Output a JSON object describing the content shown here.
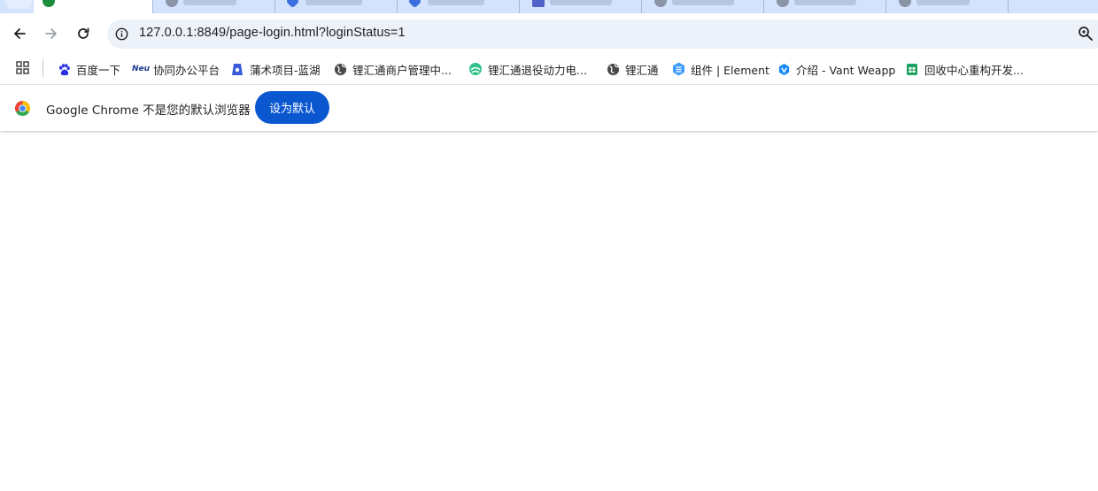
{
  "toolbar": {
    "url": "127.0.0.1:8849/page-login.html?loginStatus=1",
    "back_icon": "arrow-left-icon",
    "forward_icon": "arrow-right-icon",
    "reload_icon": "reload-icon",
    "info_icon": "info-circle-icon",
    "zoom_icon": "zoom-magnifier-icon"
  },
  "bookmarks": {
    "items": [
      {
        "label": "百度一下",
        "icon": "baidu-paw-icon"
      },
      {
        "label": "协同办公平台",
        "icon": "neu-logo-icon",
        "badge": "Neu"
      },
      {
        "label": "蒲术项目-蓝湖",
        "icon": "lanhu-icon"
      },
      {
        "label": "锂汇通商户管理中...",
        "icon": "globe-icon"
      },
      {
        "label": "锂汇通退役动力电...",
        "icon": "green-leaf-icon"
      },
      {
        "label": "锂汇通",
        "icon": "globe-icon"
      },
      {
        "label": "组件 | Element",
        "icon": "element-hex-icon"
      },
      {
        "label": "介绍 - Vant Weapp",
        "icon": "vant-icon"
      },
      {
        "label": "回收中心重构开发...",
        "icon": "sheets-icon"
      }
    ]
  },
  "infobar": {
    "message": "Google Chrome 不是您的默认浏览器",
    "button_label": "设为默认"
  },
  "colors": {
    "tab_strip": "#d3e3fd",
    "omnibox": "#edf2fa",
    "primary_button": "#0b57d0"
  }
}
